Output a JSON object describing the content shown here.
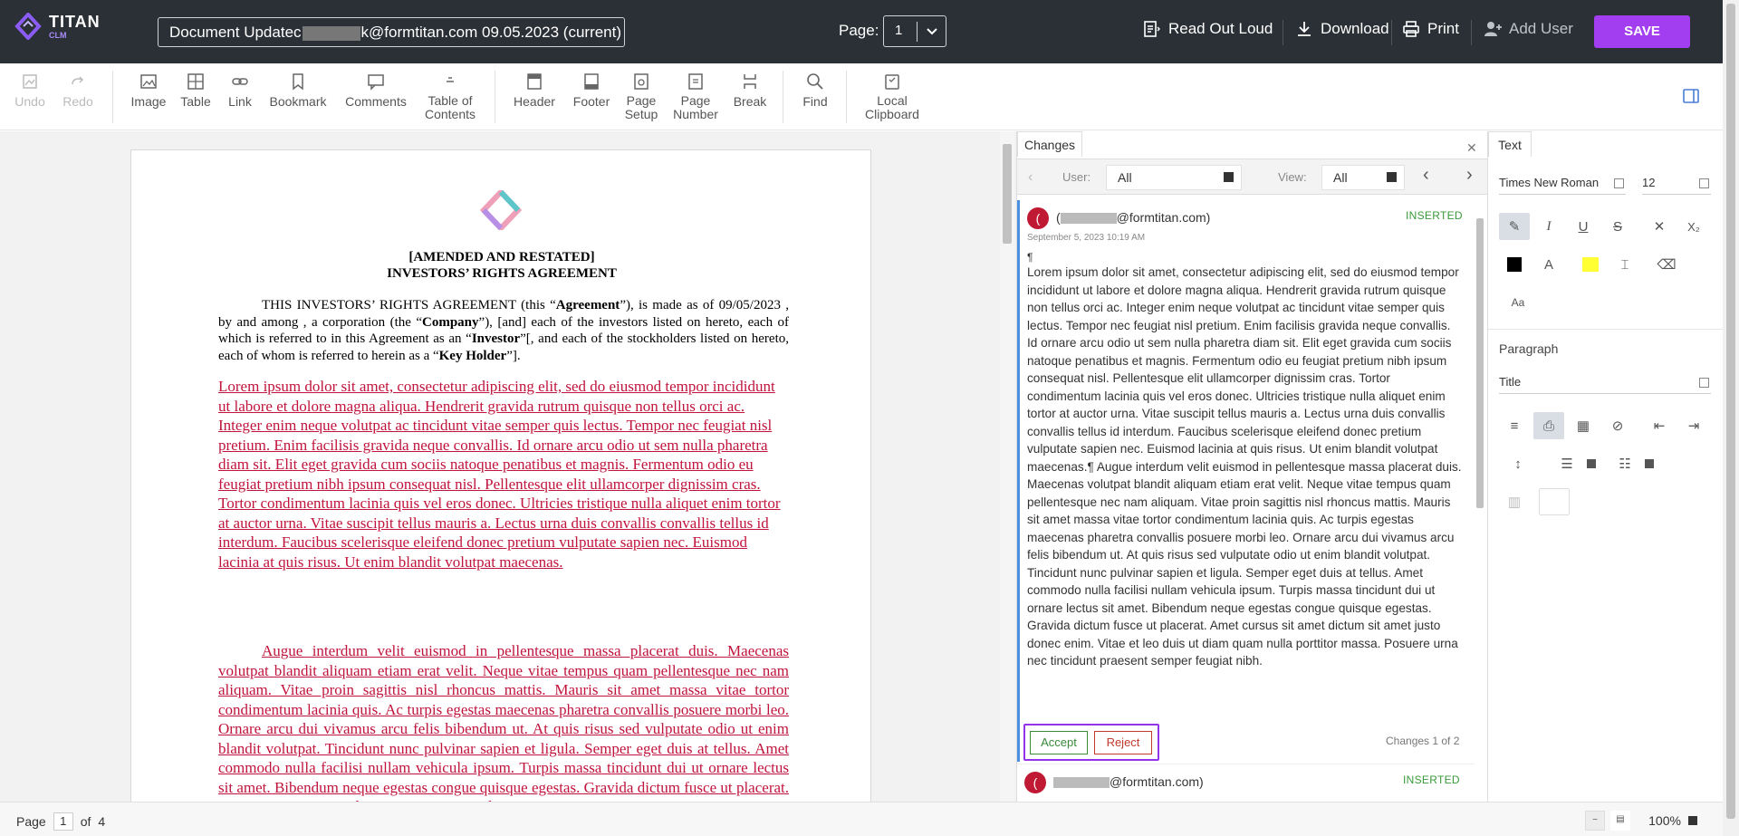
{
  "app": {
    "name": "TITAN",
    "sub": "CLM"
  },
  "header": {
    "doc_title_prefix": "Document Updatec",
    "doc_title_suffix": "k@formtitan.com 09.05.2023 (current)",
    "page_label": "Page:",
    "page_value": "1",
    "read_out_loud": "Read Out Loud",
    "download": "Download",
    "print": "Print",
    "add_user": "Add User",
    "save": "SAVE"
  },
  "ribbon": {
    "undo": "Undo",
    "redo": "Redo",
    "image": "Image",
    "table": "Table",
    "link": "Link",
    "bookmark": "Bookmark",
    "comments": "Comments",
    "toc_1": "Table of",
    "toc_2": "Contents",
    "header": "Header",
    "footer": "Footer",
    "page_setup_1": "Page",
    "page_setup_2": "Setup",
    "page_number_1": "Page",
    "page_number_2": "Number",
    "break": "Break",
    "find": "Find",
    "clipboard_1": "Local",
    "clipboard_2": "Clipboard"
  },
  "document": {
    "title_1": "[AMENDED AND RESTATED]",
    "title_2": "INVESTORS’ RIGHTS AGREEMENT",
    "intro_a": "THIS INVESTORS’ RIGHTS AGREEMENT (this “",
    "intro_agreement": "Agreement",
    "intro_b": "”), is made as of 09/05/2023 , by and among , a corporation (the “",
    "intro_company": "Company",
    "intro_c": "”), [and] each of the investors listed on hereto, each of which is referred to in this Agreement as an “",
    "intro_investor": "Investor",
    "intro_d": "”[, and each of the stockholders listed on hereto, each of whom is referred to herein as a “",
    "intro_keyholder": "Key Holder",
    "intro_e": "”].",
    "para1": "Lorem ipsum dolor sit amet, consectetur adipiscing elit, sed do eiusmod tempor incididunt ut labore et dolore magna aliqua. Hendrerit gravida rutrum quisque non tellus orci ac. Integer enim neque volutpat ac tincidunt vitae semper quis lectus. Tempor nec feugiat nisl pretium. Enim facilisis gravida neque convallis. Id ornare arcu odio ut sem nulla pharetra diam sit. Elit eget gravida cum sociis natoque penatibus et magnis. Fermentum odio eu feugiat pretium nibh ipsum consequat nisl. Pellentesque elit ullamcorper dignissim cras. Tortor condimentum lacinia quis vel eros donec. Ultricies tristique nulla aliquet enim tortor at auctor urna. Vitae suscipit tellus mauris a. Lectus urna duis convallis convallis tellus id interdum. Faucibus scelerisque eleifend donec pretium vulputate sapien nec. Euismod lacinia at quis risus. Ut enim blandit volutpat maecenas.",
    "para2": "Augue interdum velit euismod in pellentesque massa placerat duis. Maecenas volutpat blandit aliquam etiam erat velit. Neque vitae tempus quam pellentesque nec nam aliquam. Vitae proin sagittis nisl rhoncus mattis. Mauris sit amet massa vitae tortor condimentum lacinia quis. Ac turpis egestas maecenas pharetra convallis posuere morbi leo. Ornare arcu dui vivamus arcu felis bibendum ut. At quis risus sed vulputate odio ut enim blandit volutpat. Tincidunt nunc pulvinar sapien et ligula. Semper eget duis at tellus. Amet commodo nulla facilisi nullam vehicula ipsum. Turpis massa tincidunt dui ut ornare lectus sit amet. Bibendum neque egestas congue quisque egestas. Gravida dictum fusce ut placerat. Amet cursus sit amet dictum sit amet justo donec enim."
  },
  "changes": {
    "tab": "Changes",
    "user_label": "User:",
    "user_value": "All",
    "view_label": "View:",
    "view_value": "All",
    "card1": {
      "avatar": "(",
      "email_prefix": "(",
      "email_suffix": "@formtitan.com)",
      "status": "INSERTED",
      "date": "September 5, 2023 10:19 AM",
      "pilcrow": "¶",
      "text1": "Lorem ipsum dolor sit amet, consectetur adipiscing elit, sed do eiusmod tempor incididunt ut labore et dolore magna aliqua. Hendrerit gravida rutrum quisque non tellus orci ac. Integer enim neque volutpat ac tincidunt vitae semper quis lectus. Tempor nec feugiat nisl pretium. Enim facilisis gravida neque convallis. Id ornare arcu odio ut sem nulla pharetra diam sit. Elit eget gravida cum sociis natoque penatibus et magnis. Fermentum odio eu feugiat pretium nibh ipsum consequat nisl. Pellentesque elit ullamcorper dignissim cras. Tortor condimentum lacinia quis vel eros donec. Ultricies tristique nulla aliquet enim tortor at auctor urna. Vitae suscipit tellus mauris a. Lectus urna duis convallis convallis tellus id interdum. Faucibus scelerisque eleifend donec pretium vulputate sapien nec. Euismod lacinia at quis risus. Ut enim blandit volutpat maecenas.¶",
      "text2": "Augue interdum velit euismod in pellentesque massa placerat duis. Maecenas volutpat blandit aliquam etiam erat velit. Neque vitae tempus quam pellentesque nec nam aliquam. Vitae proin sagittis nisl rhoncus mattis. Mauris sit amet massa vitae tortor condimentum lacinia quis. Ac turpis egestas maecenas pharetra convallis posuere morbi leo. Ornare arcu dui vivamus arcu felis bibendum ut. At quis risus sed vulputate odio ut enim blandit volutpat. Tincidunt nunc pulvinar sapien et ligula. Semper eget duis at tellus. Amet commodo nulla facilisi nullam vehicula ipsum. Turpis massa tincidunt dui ut ornare lectus sit amet. Bibendum neque egestas congue quisque egestas. Gravida dictum fusce ut placerat. Amet cursus sit amet dictum sit amet justo donec enim. Vitae et leo duis ut diam quam nulla porttitor massa. Posuere urna nec tincidunt praesent semper feugiat nibh.",
      "accept": "Accept",
      "reject": "Reject",
      "counter": "Changes 1 of 2"
    },
    "card2": {
      "avatar": "(",
      "email_suffix": "@formtitan.com)",
      "status": "INSERTED"
    }
  },
  "format_panel": {
    "tab": "Text",
    "font": "Times New Roman",
    "size": "12",
    "paragraph_head": "Paragraph",
    "style": "Title",
    "case_label": "Aa",
    "subscript": "X₂"
  },
  "statusbar": {
    "page_label": "Page",
    "page_value": "1",
    "of_label": "of",
    "page_total": "4",
    "zoom": "100%"
  },
  "colors": {
    "accent": "#9333ea",
    "insert_red": "#c0143c",
    "status_green": "#3a9a3a",
    "topbar": "#2b3036"
  }
}
